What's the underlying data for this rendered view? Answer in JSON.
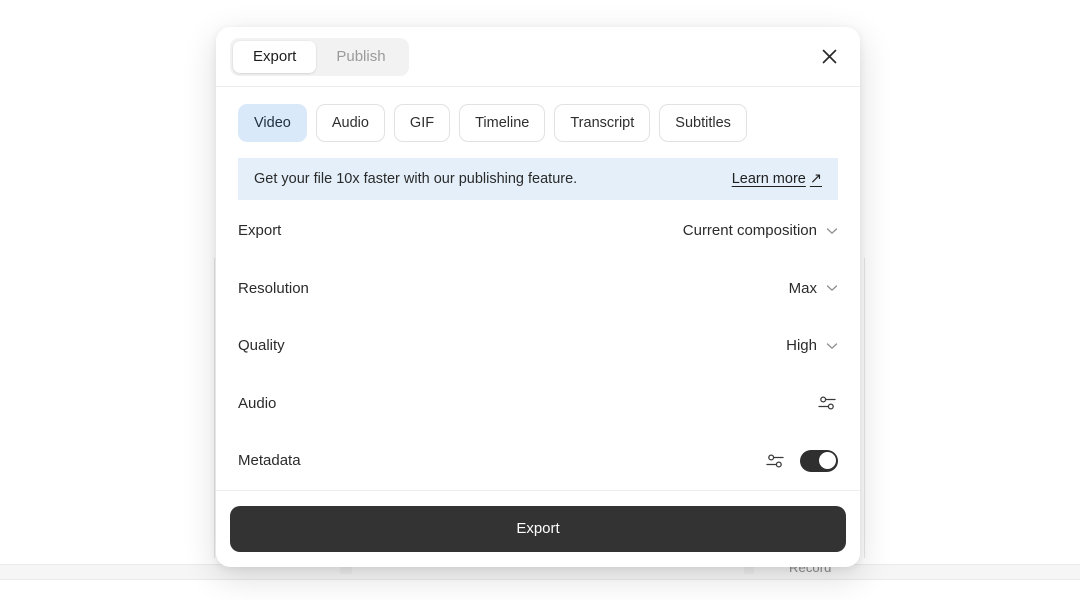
{
  "modal": {
    "header": {
      "tabs": [
        {
          "label": "Export",
          "active": true
        },
        {
          "label": "Publish",
          "active": false
        }
      ],
      "close_icon": "close-icon"
    },
    "formats": [
      {
        "label": "Video",
        "selected": true
      },
      {
        "label": "Audio",
        "selected": false
      },
      {
        "label": "GIF",
        "selected": false
      },
      {
        "label": "Timeline",
        "selected": false
      },
      {
        "label": "Transcript",
        "selected": false
      },
      {
        "label": "Subtitles",
        "selected": false
      }
    ],
    "promo": {
      "text": "Get your file 10x faster with our publishing feature.",
      "link_label": "Learn more",
      "link_arrow": "↗"
    },
    "settings": [
      {
        "label": "Export",
        "value": "Current composition",
        "control": "dropdown"
      },
      {
        "label": "Resolution",
        "value": "Max",
        "control": "dropdown"
      },
      {
        "label": "Quality",
        "value": "High",
        "control": "dropdown"
      },
      {
        "label": "Audio",
        "value": "",
        "control": "sliders"
      },
      {
        "label": "Metadata",
        "value": "",
        "control": "sliders-toggle",
        "toggle_on": true
      }
    ],
    "footer": {
      "primary_label": "Export"
    }
  },
  "background": {
    "record_label": "Record"
  },
  "colors": {
    "accent_chip": "#d9e9f9",
    "promo_background": "#e4eff9",
    "primary_button": "#333333",
    "toggle_on": "#2f2f2f",
    "modal_background": "#ffffff"
  }
}
